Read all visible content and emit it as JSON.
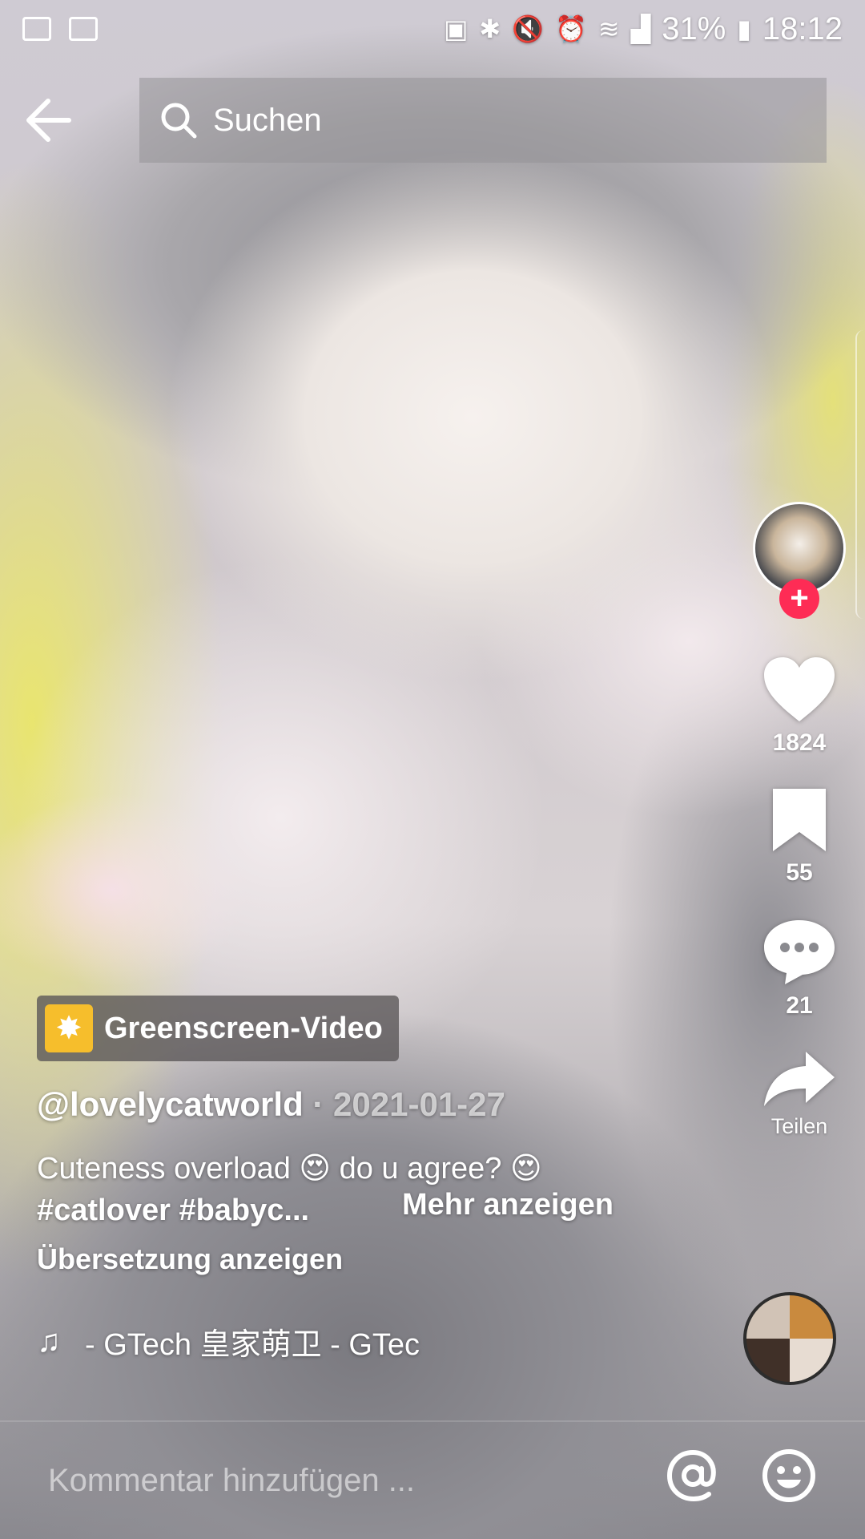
{
  "status_bar": {
    "battery": "31%",
    "time": "18:12",
    "left_icons": [
      "image-icon",
      "folder-icon"
    ],
    "right_icons": [
      "battery-saver-icon",
      "bluetooth-icon",
      "mute-icon",
      "alarm-icon",
      "wifi-icon",
      "signal-icon",
      "battery-icon"
    ]
  },
  "header": {
    "back_icon": "back-arrow-icon",
    "search_placeholder": "Suchen"
  },
  "right_rail": {
    "likes": "1824",
    "saves": "55",
    "comments": "21",
    "share_label": "Teilen"
  },
  "video": {
    "effect_label": "Greenscreen-Video",
    "author": "@lovelycatworld",
    "date": "2021-01-27",
    "caption": "Cuteness overload 😍 do u agree? 😍",
    "tags": "#catlover  #babyc...",
    "more_label": "Mehr anzeigen",
    "translate_label": "Übersetzung anzeigen",
    "sound": " - GTech    皇家萌卫 - GTec"
  },
  "comment": {
    "placeholder": "Kommentar hinzufügen ..."
  },
  "colors": {
    "accent": "#fe2c55",
    "effect_badge": "#f6be2c"
  }
}
